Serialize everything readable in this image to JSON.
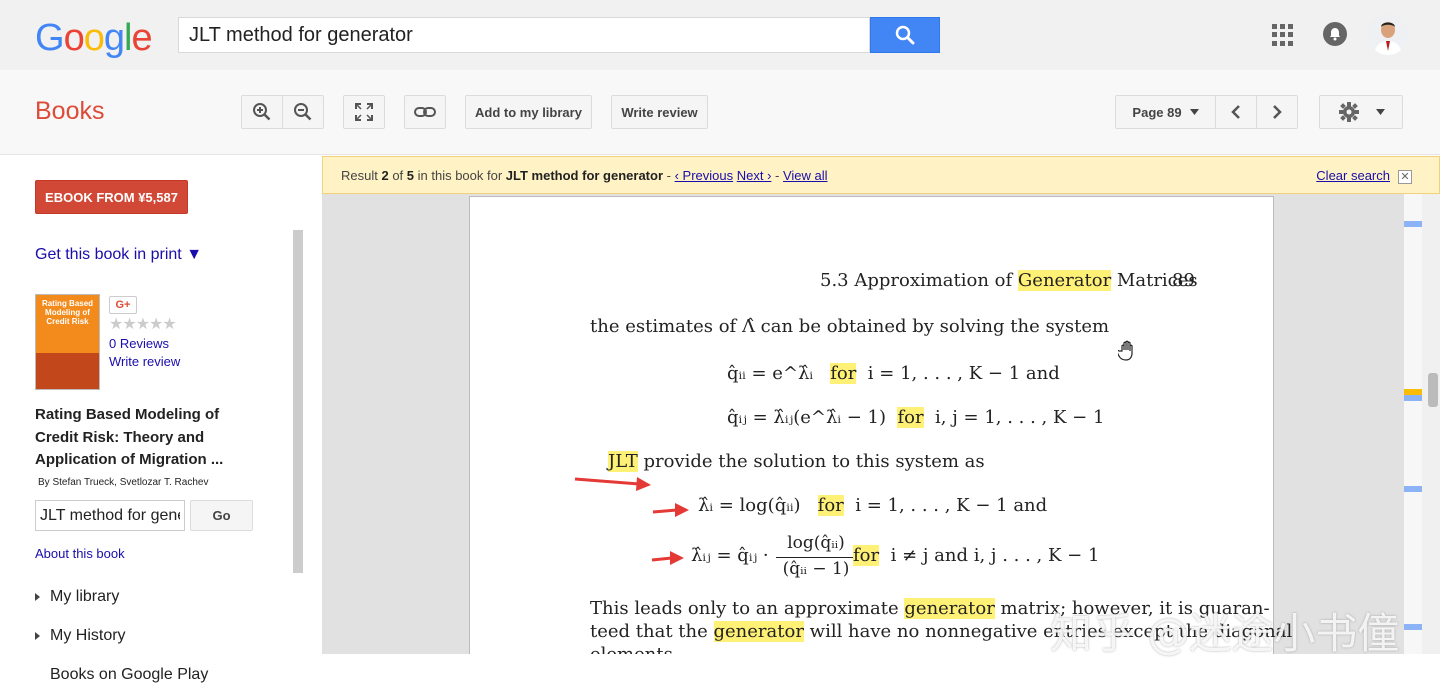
{
  "header": {
    "logo": "Google",
    "search_value": "JLT method for generator",
    "search_icon": "search-icon",
    "apps_icon": "apps-grid-icon",
    "notifications_icon": "bell-icon",
    "avatar_icon": "user-avatar"
  },
  "toolbar": {
    "section_title": "Books",
    "zoom_in_icon": "zoom-in-icon",
    "zoom_out_icon": "zoom-out-icon",
    "fullscreen_icon": "fullscreen-icon",
    "link_icon": "link-icon",
    "add_library_label": "Add to my library",
    "write_review_label": "Write review",
    "page_label": "Page 89",
    "prev_icon": "chevron-left-icon",
    "next_icon": "chevron-right-icon",
    "settings_icon": "gear-icon"
  },
  "sidebar": {
    "ebook_label": "EBOOK FROM ¥5,587",
    "print_link": "Get this book in print ▼",
    "gplus_label": "G+",
    "stars": "★★★★★",
    "rating": 0,
    "reviews_link": "0 Reviews",
    "write_review_link": "Write review",
    "book_title": "Rating Based Modeling of Credit Risk: Theory and Application of Migration ...",
    "book_authors": "By Stefan Trueck, Svetlozar T. Rachev",
    "cover_text": "Rating Based Modeling of Credit Risk",
    "in_book_search_value": "JLT method for generator",
    "go_label": "Go",
    "about_link": "About this book",
    "nav_items": [
      {
        "label": "My library"
      },
      {
        "label": "My History"
      },
      {
        "label": "Books on Google Play"
      }
    ]
  },
  "result_bar": {
    "prefix": "Result ",
    "result_index": "2",
    "of": " of ",
    "result_total": "5",
    "middle": " in this book for ",
    "query": "JLT method for generator",
    "dash1": " - ",
    "previous": "‹ Previous",
    "next": "Next ›",
    "dash2": " - ",
    "view_all": "View all",
    "clear_search": "Clear search",
    "close_icon": "close-icon"
  },
  "page": {
    "header_prefix": "5.3 Approximation of ",
    "header_highlight": "Generator",
    "header_suffix": " Matrices",
    "page_number": "89",
    "line1": "the estimates of Λ̂ can be obtained by solving the system",
    "eq1_left": "q̂ᵢᵢ = e^λ̂ᵢ",
    "eq1_for": "for",
    "eq1_right": "i = 1, . . . , K − 1  and",
    "eq2_left": "q̂ᵢⱼ = λ̂ᵢⱼ(e^λ̂ᵢ − 1)",
    "eq2_for": "for",
    "eq2_right": "i, j = 1, . . . , K − 1",
    "jlt_highlight": "JLT",
    "jlt_rest": " provide the solution to this system as",
    "eq3_left": "λ̂ᵢ = log(q̂ᵢᵢ)",
    "eq3_for": "for",
    "eq3_right": "i = 1, . . . , K − 1  and",
    "eq4_left": "λ̂ᵢⱼ = q̂ᵢⱼ ·",
    "eq4_num": "log(q̂ᵢᵢ)",
    "eq4_den": "(q̂ᵢᵢ − 1)",
    "eq4_for": "for",
    "eq4_right": "i ≠ j  and  i, j  . . . , K − 1",
    "para1_a": "This leads only to an approximate ",
    "para1_hl": "generator",
    "para1_b": " matrix; however, it is guaran-",
    "para2_a": "teed that the ",
    "para2_hl": "generator",
    "para2_b": " will have no nonnegative entries except the diagonal",
    "para3": "elements."
  },
  "watermark": "知乎 @迷途小书僮",
  "colors": {
    "accent_blue": "#4285f4",
    "books_red": "#dd4b39",
    "ebook_red": "#d14836",
    "highlight": "#fff176",
    "result_bar": "#fff3c6",
    "arrow_red": "#e53935"
  }
}
